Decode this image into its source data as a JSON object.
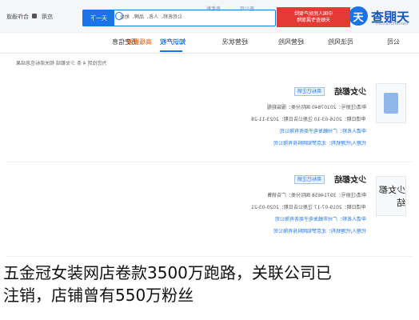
{
  "topbar": {
    "logo_text": "天眼查",
    "logo_sub": "TianYanCha.com",
    "search_button": "天一下",
    "search_value": "公司名称、人名、品牌、地址",
    "search_tag": "查公司",
    "search_tag2": "查老板",
    "ad_line1": "中国人民财产保险",
    "ad_line2": "天眼查专属保障",
    "nav_items": [
      "应用",
      "合作通道"
    ]
  },
  "tabs": [
    {
      "label": "公司",
      "active": false
    },
    {
      "label": "司法风险",
      "active": false
    },
    {
      "label": "经营风险",
      "active": false
    },
    {
      "label": "经营状况",
      "active": false
    },
    {
      "label": "知识产权",
      "active": true
    },
    {
      "label": "历史信息",
      "active": false
    },
    {
      "label": "高级搜索",
      "active": false
    }
  ],
  "result_header": "为您找到 4 条  少女都结  相关商标信息结果",
  "cards": [
    {
      "title": "少女都结",
      "badge": "商标已注销",
      "thumb": "book",
      "rows": [
        {
          "text": "申请/注册号：20107840    国际分类：服装鞋帽",
          "link": false
        },
        {
          "text": "申请日期：2016-03-10    注册公告日期：2023-11-28",
          "link": false
        },
        {
          "text": "申请人名称：广州触发电子商务有限公司",
          "link": true
        },
        {
          "text": "代理人/代理机构：北京梦知网科技有限公司",
          "link": true
        }
      ]
    },
    {
      "title": "少女都结",
      "badge": "商标已注销",
      "thumb": "glyph",
      "thumb_text": "少女都结",
      "rows": [
        {
          "text": "申请/注册号：39714658    国际分类：广告销售",
          "link": false
        },
        {
          "text": "申请日期：2019-07-17    注册公告日期：2020-03-21",
          "link": false
        },
        {
          "text": "申请人名称：广州市触发电子商务有限公司",
          "link": true
        },
        {
          "text": "代理人/代理机构：北京梦知网科技有限公司",
          "link": true
        }
      ]
    }
  ],
  "caption": {
    "line1": "五金冠女装网店卷款3500万跑路，关联公司已",
    "line2": "注销，店铺曾有550万粉丝"
  }
}
